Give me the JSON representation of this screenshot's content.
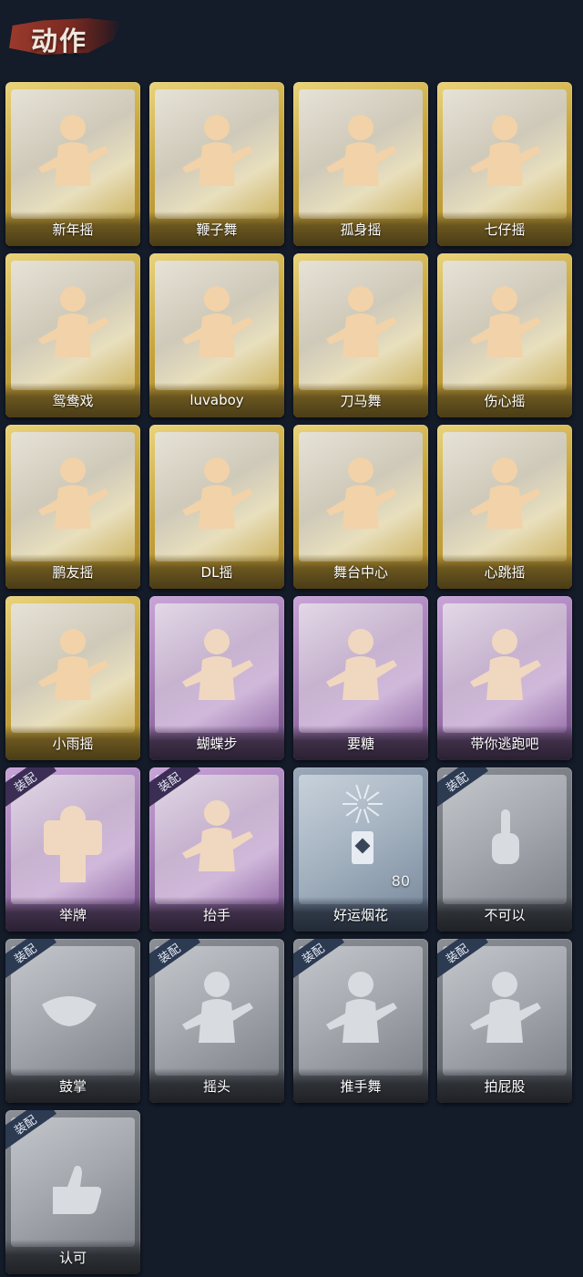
{
  "header": {
    "title": "动作"
  },
  "colors": {
    "gold": "#c7a53c",
    "purple": "#9a74ad",
    "blue": "#74849a",
    "gray": "#6a6e75",
    "background": "#141b29"
  },
  "actions": [
    {
      "label": "新年摇",
      "rarity": "gold",
      "badge": "",
      "count": "",
      "icon": "figure-clap-icon"
    },
    {
      "label": "鞭子舞",
      "rarity": "gold",
      "badge": "",
      "count": "",
      "icon": "figure-heart-icon"
    },
    {
      "label": "孤身摇",
      "rarity": "gold",
      "badge": "",
      "count": "",
      "icon": "figure-stars-icon"
    },
    {
      "label": "七仔摇",
      "rarity": "gold",
      "badge": "",
      "count": "",
      "icon": "figure-music-icon"
    },
    {
      "label": "鸳鸯戏",
      "rarity": "gold",
      "badge": "",
      "count": "",
      "icon": "figure-music-icon"
    },
    {
      "label": "luvaboy",
      "rarity": "gold",
      "badge": "",
      "count": "",
      "icon": "figure-dance-icon"
    },
    {
      "label": "刀马舞",
      "rarity": "gold",
      "badge": "",
      "count": "",
      "icon": "figure-dance-icon"
    },
    {
      "label": "伤心摇",
      "rarity": "gold",
      "badge": "",
      "count": "",
      "icon": "figure-heart-hands-icon"
    },
    {
      "label": "鹏友摇",
      "rarity": "gold",
      "badge": "",
      "count": "",
      "icon": "figure-point-icon"
    },
    {
      "label": "DL摇",
      "rarity": "gold",
      "badge": "",
      "count": "",
      "icon": "figure-arm-up-icon"
    },
    {
      "label": "舞台中心",
      "rarity": "gold",
      "badge": "",
      "count": "",
      "icon": "figure-stars-icon"
    },
    {
      "label": "心跳摇",
      "rarity": "gold",
      "badge": "",
      "count": "",
      "icon": "figure-music-icon"
    },
    {
      "label": "小雨摇",
      "rarity": "gold",
      "badge": "",
      "count": "",
      "icon": "figure-music-icon"
    },
    {
      "label": "蝴蝶步",
      "rarity": "purple",
      "badge": "",
      "count": "",
      "icon": "figure-arms-out-icon"
    },
    {
      "label": "要糖",
      "rarity": "purple",
      "badge": "",
      "count": "",
      "icon": "figure-reach-icon"
    },
    {
      "label": "带你逃跑吧",
      "rarity": "purple",
      "badge": "",
      "count": "",
      "icon": "figure-point-icon"
    },
    {
      "label": "举牌",
      "rarity": "purple",
      "badge": "装配",
      "count": "",
      "icon": "sign-icon"
    },
    {
      "label": "抬手",
      "rarity": "purple",
      "badge": "装配",
      "count": "",
      "icon": "figure-raise-hand-icon"
    },
    {
      "label": "好运烟花",
      "rarity": "blue",
      "badge": "",
      "count": "80",
      "icon": "firework-icon"
    },
    {
      "label": "不可以",
      "rarity": "gray",
      "badge": "装配",
      "count": "",
      "icon": "finger-no-icon"
    },
    {
      "label": "鼓掌",
      "rarity": "gray",
      "badge": "装配",
      "count": "",
      "icon": "clap-hands-icon"
    },
    {
      "label": "摇头",
      "rarity": "gray",
      "badge": "装配",
      "count": "",
      "icon": "figure-shake-head-icon"
    },
    {
      "label": "推手舞",
      "rarity": "gray",
      "badge": "装配",
      "count": "",
      "icon": "figure-push-icon"
    },
    {
      "label": "拍屁股",
      "rarity": "gray",
      "badge": "装配",
      "count": "",
      "icon": "figure-bend-icon"
    },
    {
      "label": "认可",
      "rarity": "gray",
      "badge": "装配",
      "count": "",
      "icon": "thumbs-up-icon"
    }
  ]
}
